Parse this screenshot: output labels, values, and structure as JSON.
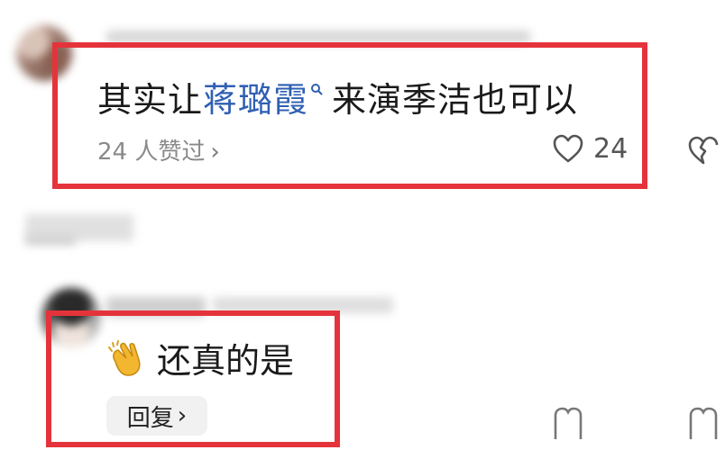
{
  "comment_1": {
    "text_before": "其实让",
    "mention": "蒋璐霞",
    "text_after": "来演季洁也可以",
    "likes_summary": "24 人赞过",
    "like_count": "24"
  },
  "comment_2": {
    "emoji_icon": "clapping-hands-icon",
    "text": "还真的是",
    "reply_label": "回复"
  },
  "colors": {
    "highlight_border": "#e5333b",
    "mention": "#2f5fb3",
    "secondary_text": "#8a8a8a"
  }
}
